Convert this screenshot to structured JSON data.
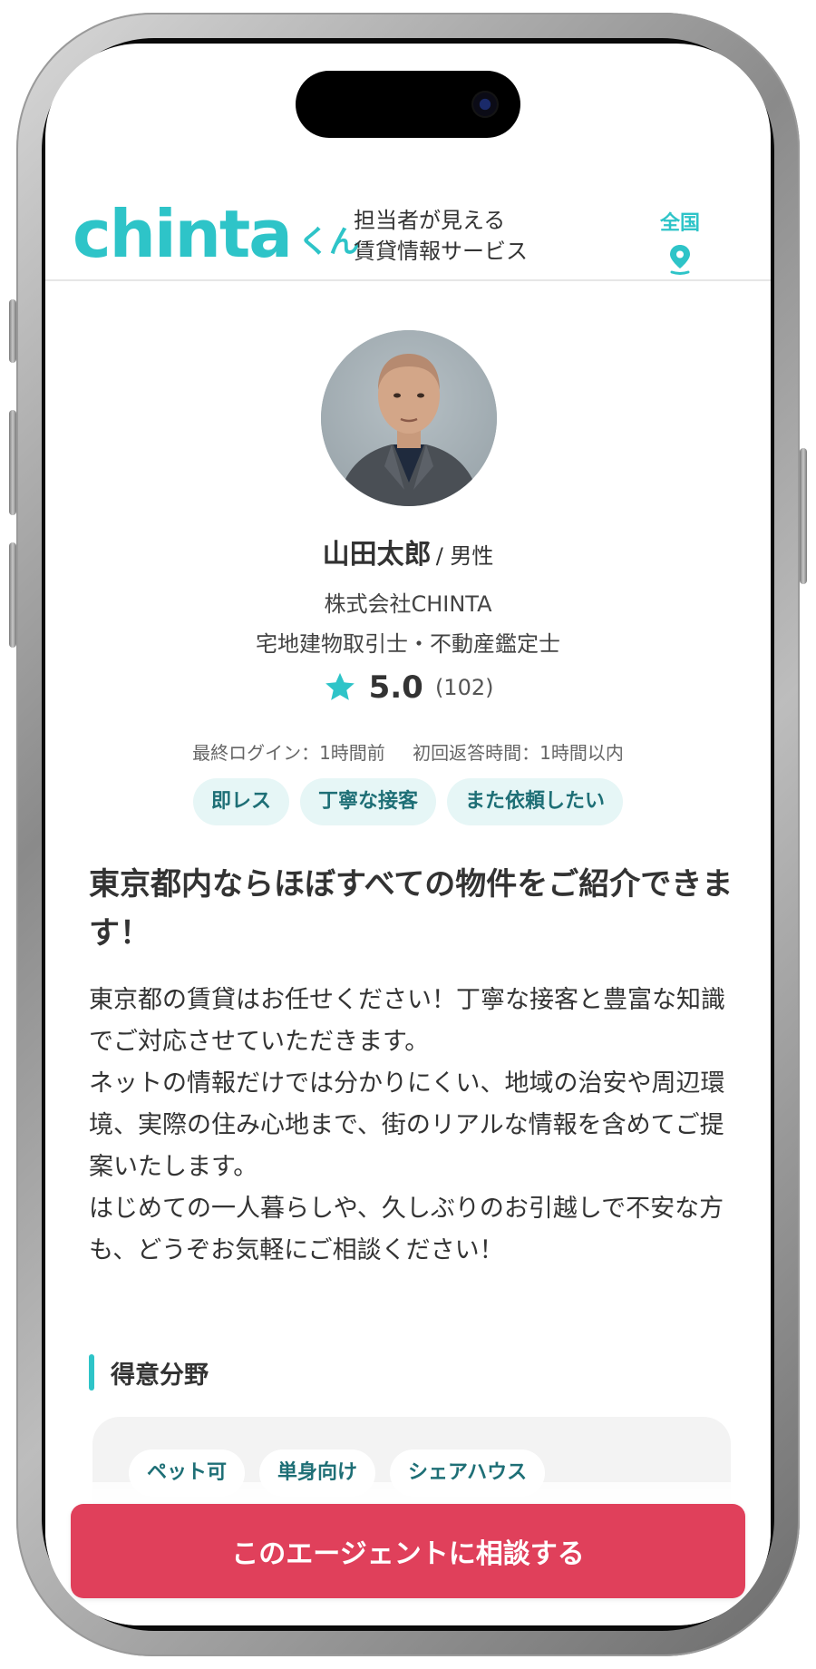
{
  "header": {
    "logo_main": "chinta",
    "logo_sub": "くん",
    "tagline_line1": "担当者が見える",
    "tagline_line2": "賃貸情報サービス",
    "region_label": "全国"
  },
  "agent": {
    "name": "山田太郎",
    "gender": "/ 男性",
    "company": "株式会社CHINTA",
    "license": "宅地建物取引士・不動産鑑定士",
    "rating": "5.0",
    "review_count": "(102)",
    "last_login": "最終ログイン：1時間前",
    "first_response": "初回返答時間：1時間以内",
    "tags": [
      "即レス",
      "丁寧な接客",
      "また依頼したい"
    ]
  },
  "intro": {
    "headline": "東京都内ならほぼすべての物件をご紹介できます！",
    "paragraph1": "東京都の賃貸はお任せください！丁寧な接客と豊富な知識でご対応させていただきます。",
    "paragraph2": "ネットの情報だけでは分かりにくい、地域の治安や周辺環境、実際の住み心地まで、街のリアルな情報を含めてご提案いたします。",
    "paragraph3": "はじめての一人暮らしや、久しぶりのお引越しで不安な方も、どうぞお気軽にご相談ください！"
  },
  "specialty": {
    "title": "得意分野",
    "tags": [
      "ペット可",
      "単身向け",
      "シェアハウス"
    ]
  },
  "cta": {
    "label": "このエージェントに相談する"
  },
  "colors": {
    "brand": "#2ec4c8",
    "cta": "#e0405b",
    "tag_bg": "#e6f6f6",
    "tag_text": "#1e6f76"
  },
  "icons": {
    "region": "map-pin-icon",
    "rating": "star-icon"
  }
}
